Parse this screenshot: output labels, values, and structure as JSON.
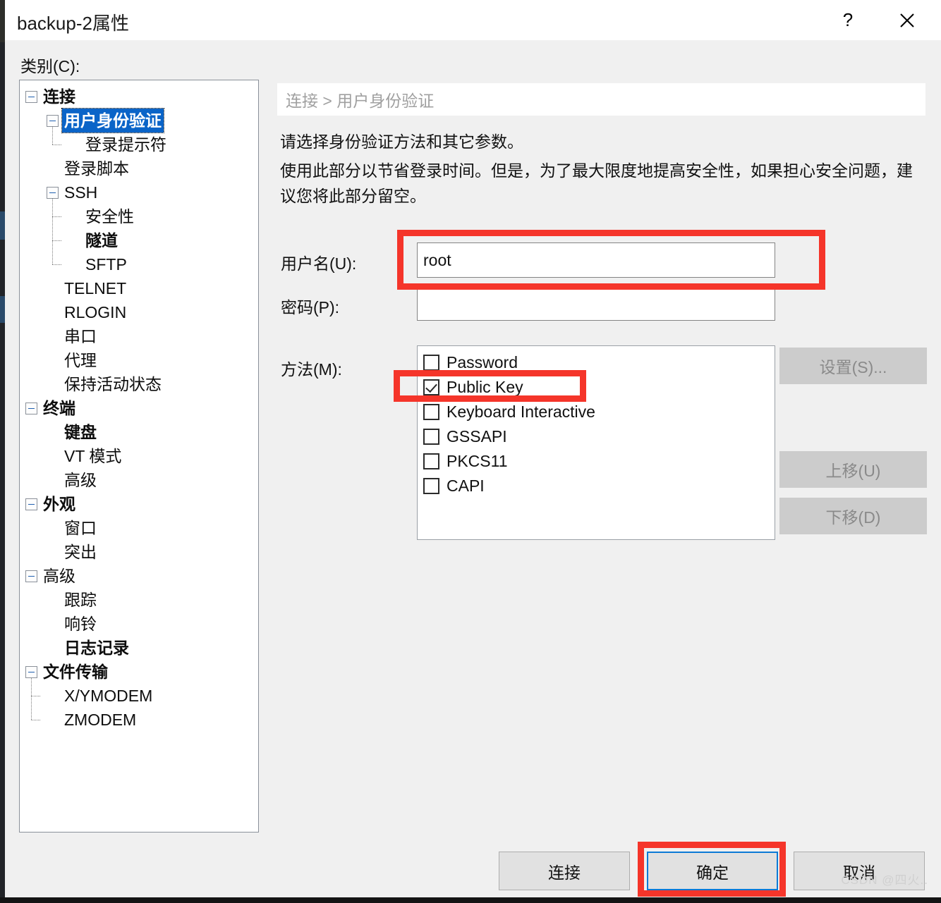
{
  "window": {
    "title": "backup-2属性",
    "help_icon": "question-mark-icon",
    "close_icon": "close-icon"
  },
  "sidebar": {
    "label": "类别(C):",
    "items": [
      {
        "label": "连接",
        "level": 0,
        "bold": true,
        "expander": true,
        "selected": false
      },
      {
        "label": "用户身份验证",
        "level": 1,
        "bold": true,
        "expander": true,
        "selected": true
      },
      {
        "label": "登录提示符",
        "level": 2,
        "bold": false,
        "expander": false,
        "selected": false
      },
      {
        "label": "登录脚本",
        "level": 1,
        "bold": false,
        "expander": false,
        "selected": false
      },
      {
        "label": "SSH",
        "level": 1,
        "bold": false,
        "expander": true,
        "selected": false
      },
      {
        "label": "安全性",
        "level": 2,
        "bold": false,
        "expander": false,
        "selected": false
      },
      {
        "label": "隧道",
        "level": 2,
        "bold": true,
        "expander": false,
        "selected": false
      },
      {
        "label": "SFTP",
        "level": 2,
        "bold": false,
        "expander": false,
        "selected": false
      },
      {
        "label": "TELNET",
        "level": 1,
        "bold": false,
        "expander": false,
        "selected": false
      },
      {
        "label": "RLOGIN",
        "level": 1,
        "bold": false,
        "expander": false,
        "selected": false
      },
      {
        "label": "串口",
        "level": 1,
        "bold": false,
        "expander": false,
        "selected": false
      },
      {
        "label": "代理",
        "level": 1,
        "bold": false,
        "expander": false,
        "selected": false
      },
      {
        "label": "保持活动状态",
        "level": 1,
        "bold": false,
        "expander": false,
        "selected": false
      },
      {
        "label": "终端",
        "level": 0,
        "bold": true,
        "expander": true,
        "selected": false
      },
      {
        "label": "键盘",
        "level": 1,
        "bold": true,
        "expander": false,
        "selected": false
      },
      {
        "label": "VT 模式",
        "level": 1,
        "bold": false,
        "expander": false,
        "selected": false
      },
      {
        "label": "高级",
        "level": 1,
        "bold": false,
        "expander": false,
        "selected": false
      },
      {
        "label": "外观",
        "level": 0,
        "bold": true,
        "expander": true,
        "selected": false
      },
      {
        "label": "窗口",
        "level": 1,
        "bold": false,
        "expander": false,
        "selected": false
      },
      {
        "label": "突出",
        "level": 1,
        "bold": false,
        "expander": false,
        "selected": false
      },
      {
        "label": "高级",
        "level": 0,
        "bold": false,
        "expander": true,
        "selected": false
      },
      {
        "label": "跟踪",
        "level": 1,
        "bold": false,
        "expander": false,
        "selected": false
      },
      {
        "label": "响铃",
        "level": 1,
        "bold": false,
        "expander": false,
        "selected": false
      },
      {
        "label": "日志记录",
        "level": 1,
        "bold": true,
        "expander": false,
        "selected": false
      },
      {
        "label": "文件传输",
        "level": 0,
        "bold": true,
        "expander": true,
        "selected": false
      },
      {
        "label": "X/YMODEM",
        "level": 1,
        "bold": false,
        "expander": false,
        "selected": false
      },
      {
        "label": "ZMODEM",
        "level": 1,
        "bold": false,
        "expander": false,
        "selected": false
      }
    ]
  },
  "main": {
    "breadcrumb": "连接 > 用户身份验证",
    "description_line1": "请选择身份验证方法和其它参数。",
    "description_line2": "使用此部分以节省登录时间。但是，为了最大限度地提高安全性，如果担心安全问题，建议您将此部分留空。",
    "username_label": "用户名(U):",
    "username_value": "root",
    "password_label": "密码(P):",
    "password_value": "",
    "method_label": "方法(M):",
    "methods": [
      {
        "label": "Password",
        "checked": false
      },
      {
        "label": "Public Key",
        "checked": true
      },
      {
        "label": "Keyboard Interactive",
        "checked": false
      },
      {
        "label": "GSSAPI",
        "checked": false
      },
      {
        "label": "PKCS11",
        "checked": false
      },
      {
        "label": "CAPI",
        "checked": false
      }
    ],
    "side_buttons": {
      "settings": "设置(S)...",
      "move_up": "上移(U)",
      "move_down": "下移(D)"
    }
  },
  "footer": {
    "connect": "连接",
    "ok": "确定",
    "cancel": "取消"
  },
  "watermark": "CSDN @四火..",
  "colors": {
    "selection_blue": "#0a64c8",
    "annotation_red": "#f5352a",
    "focus_blue": "#0c7ad6",
    "dialog_bg": "#f0f0f0"
  }
}
